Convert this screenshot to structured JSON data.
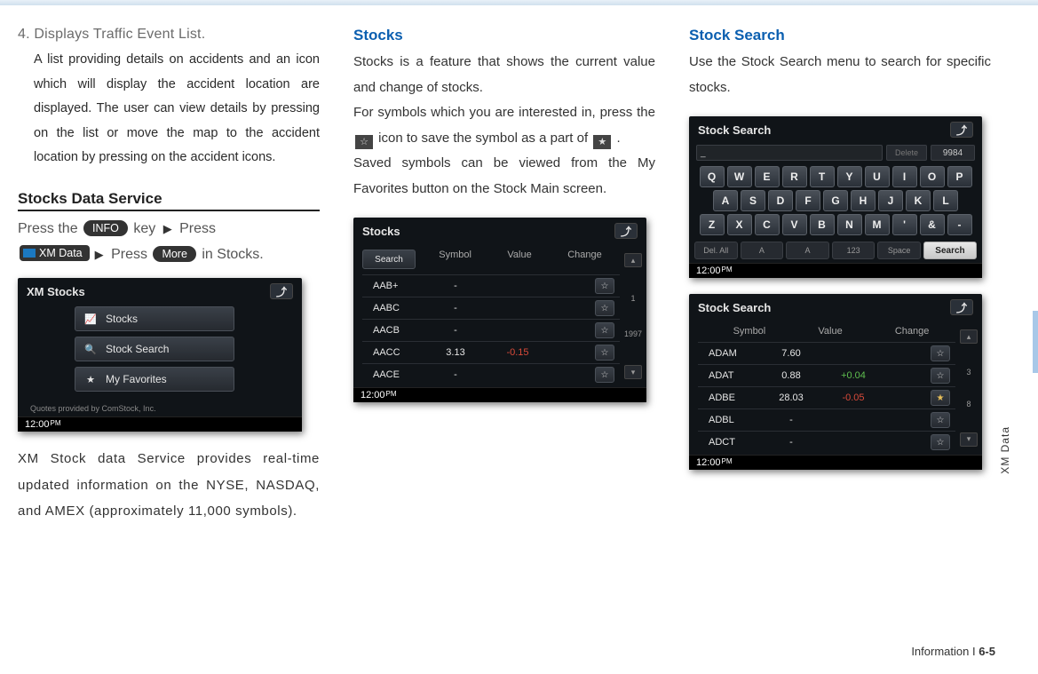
{
  "col1": {
    "item_num": "4.",
    "item_title": "Displays Traffic Event List.",
    "item_body": "A list providing details on accidents and an icon which will display the accident location are displayed. The user can view details by pressing on the list or move the map to the accident location by pressing on the accident icons.",
    "section_heading": "Stocks Data Service",
    "instr_press_the": "Press the ",
    "pill_info": "INFO",
    "instr_key": " key ",
    "instr_press": " Press ",
    "pill_xmdata": "XM Data",
    "pill_more": "More",
    "instr_in_stocks": " in Stocks.",
    "para_after": "XM Stock data Service provides real-time updated information on the NYSE, NASDAQ, and AMEX (approximately 11,000 symbols)."
  },
  "col2": {
    "title": "Stocks",
    "p1": "Stocks is a feature that shows the current value and change of stocks.",
    "p2a": "For symbols which you are interested in, press the ",
    "p2b": " icon to save the symbol as a part of ",
    "p2c": " .",
    "p3": "Saved symbols can be viewed from the My Favorites button on the Stock Main screen."
  },
  "col3": {
    "title": "Stock Search",
    "p1": "Use the Stock Search menu to search for specific stocks."
  },
  "scr_xmstocks": {
    "title": "XM Stocks",
    "menu": [
      "Stocks",
      "Stock Search",
      "My Favorites"
    ],
    "note": "Quotes provided by ComStock, Inc.",
    "clock": "12:00",
    "ampm": "PM"
  },
  "scr_stocks": {
    "title": "Stocks",
    "search": "Search",
    "headers": [
      "Symbol",
      "Value",
      "Change"
    ],
    "rows": [
      {
        "sym": "AAB+",
        "val": "-",
        "chg": ""
      },
      {
        "sym": "AABC",
        "val": "-",
        "chg": ""
      },
      {
        "sym": "AACB",
        "val": "-",
        "chg": ""
      },
      {
        "sym": "AACC",
        "val": "3.13",
        "chg": "-0.15",
        "neg": true
      },
      {
        "sym": "AACE",
        "val": "-",
        "chg": ""
      }
    ],
    "scroll_top": "1",
    "scroll_bot": "1997",
    "clock": "12:00",
    "ampm": "PM"
  },
  "scr_kbd": {
    "title": "Stock Search",
    "input": "_",
    "delete": "Delete",
    "count": "9984",
    "row1": [
      "Q",
      "W",
      "E",
      "R",
      "T",
      "Y",
      "U",
      "I",
      "O",
      "P"
    ],
    "row2": [
      "A",
      "S",
      "D",
      "F",
      "G",
      "H",
      "J",
      "K",
      "L"
    ],
    "row3": [
      "Z",
      "X",
      "C",
      "V",
      "B",
      "N",
      "M",
      "'",
      "&",
      "-"
    ],
    "bottom": [
      "Del. All",
      "A",
      "A",
      "123",
      "Space"
    ],
    "search_btn": "Search",
    "clock": "12:00",
    "ampm": "PM"
  },
  "scr_results": {
    "title": "Stock Search",
    "headers": [
      "Symbol",
      "Value",
      "Change"
    ],
    "rows": [
      {
        "sym": "ADAM",
        "val": "7.60",
        "chg": ""
      },
      {
        "sym": "ADAT",
        "val": "0.88",
        "chg": "+0.04",
        "pos": true
      },
      {
        "sym": "ADBE",
        "val": "28.03",
        "chg": "-0.05",
        "neg": true,
        "fav": true
      },
      {
        "sym": "ADBL",
        "val": "-",
        "chg": ""
      },
      {
        "sym": "ADCT",
        "val": "-",
        "chg": ""
      }
    ],
    "scroll_top": "3",
    "scroll_bot": "8",
    "clock": "12:00",
    "ampm": "PM"
  },
  "side_label": "XM Data",
  "footer_section": "Information",
  "footer_sep": "  I  ",
  "footer_page": "6-5"
}
